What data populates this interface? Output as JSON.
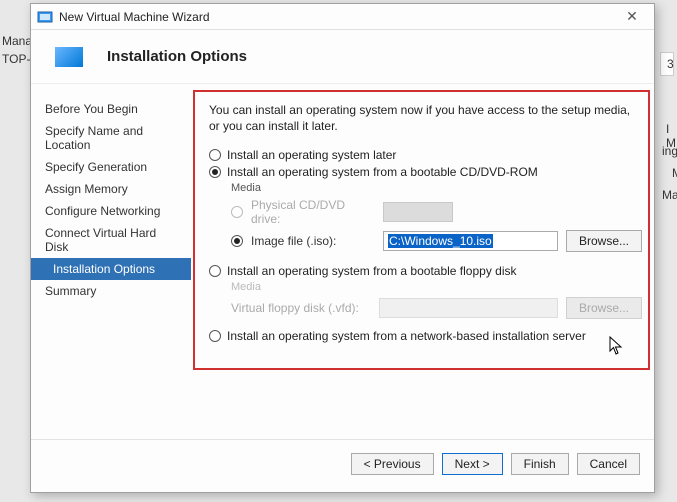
{
  "bg": {
    "manag": "Manag",
    "topv": "TOP-V",
    "three": "3",
    "lm": "I M",
    "ings": "ings.",
    "m": "M",
    "mana": "Mana"
  },
  "titlebar": {
    "title": "New Virtual Machine Wizard",
    "close": "✕"
  },
  "header": {
    "title": "Installation Options"
  },
  "sidebar": {
    "steps": [
      "Before You Begin",
      "Specify Name and Location",
      "Specify Generation",
      "Assign Memory",
      "Configure Networking",
      "Connect Virtual Hard Disk",
      "Installation Options",
      "Summary"
    ],
    "active_index": 6
  },
  "content": {
    "intro": "You can install an operating system now if you have access to the setup media, or you can install it later.",
    "opt_later": "Install an operating system later",
    "opt_cd": "Install an operating system from a bootable CD/DVD-ROM",
    "media_label": "Media",
    "physical_drive": "Physical CD/DVD drive:",
    "image_file": "Image file (.iso):",
    "iso_value": "C:\\Windows_10.iso",
    "browse": "Browse...",
    "opt_floppy": "Install an operating system from a bootable floppy disk",
    "virtual_floppy": "Virtual floppy disk (.vfd):",
    "opt_network": "Install an operating system from a network-based installation server"
  },
  "footer": {
    "previous": "< Previous",
    "next": "Next >",
    "finish": "Finish",
    "cancel": "Cancel"
  }
}
